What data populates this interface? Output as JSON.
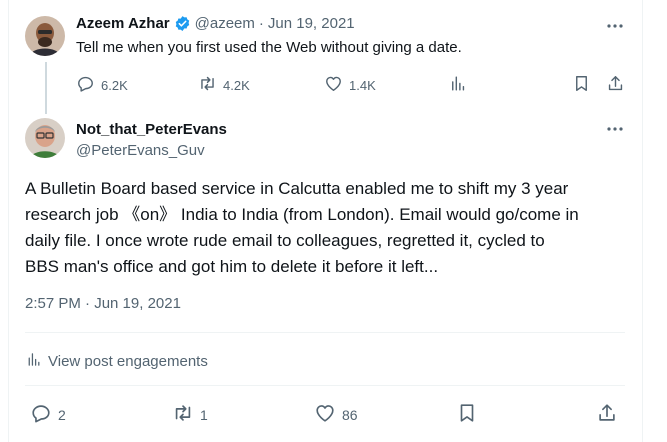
{
  "parent_tweet": {
    "author_name": "Azeem Azhar",
    "handle": "@azeem",
    "separator": "·",
    "date": "Jun 19, 2021",
    "text": "Tell me when you first used the Web without giving a date.",
    "replies": "6.2K",
    "reposts": "4.2K",
    "likes": "1.4K"
  },
  "reply_tweet": {
    "author_name": "Not_that_PeterEvans",
    "handle": "@PeterEvans_Guv",
    "text_lines": [
      "A Bulletin Board based service in Calcutta enabled me to shift my 3 year",
      "research job 《on》 India to India (from London). Email would go/come in",
      "daily file. I once wrote rude email to colleagues, regretted it, cycled to",
      "BBS man's office and got him to delete it before it left..."
    ],
    "timestamp": "2:57 PM · Jun 19, 2021",
    "engagements_label": "View post engagements",
    "replies": "2",
    "reposts": "1",
    "likes": "86"
  },
  "colors": {
    "verified": "#1d9bf0",
    "muted": "#536471",
    "text": "#0f1419",
    "divider": "#eff3f4"
  }
}
